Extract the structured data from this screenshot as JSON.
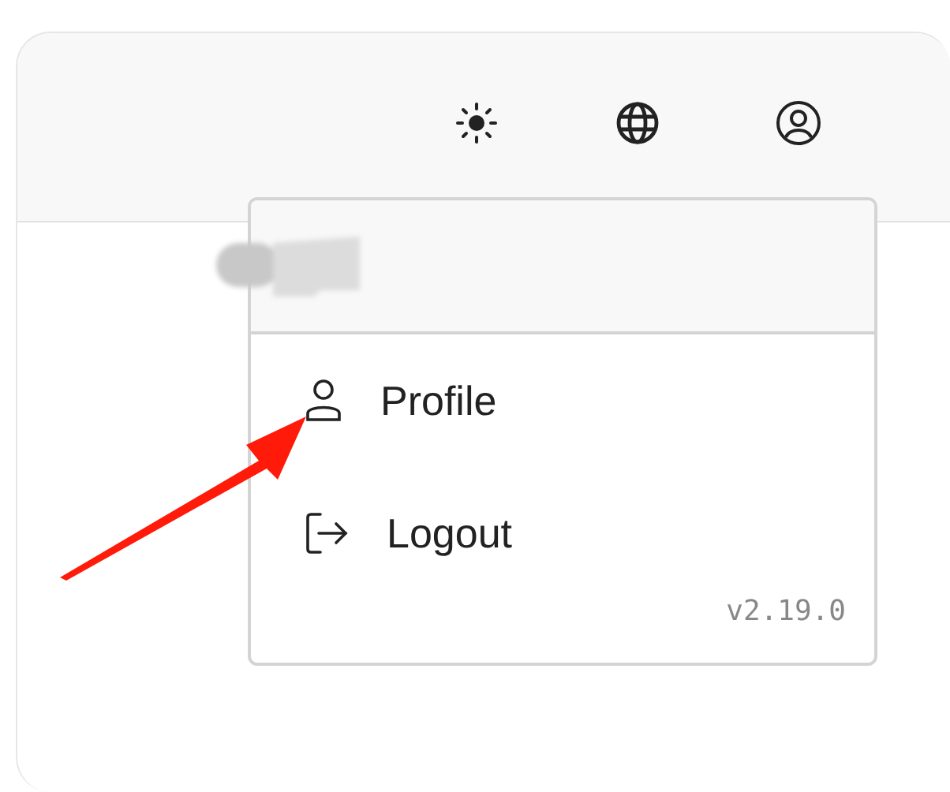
{
  "toolbar": [
    {
      "kind": "sun"
    },
    {
      "kind": "globe"
    },
    {
      "kind": "user"
    }
  ],
  "menu": {
    "items": [
      {
        "kind": "profile",
        "label": "Profile"
      },
      {
        "kind": "logout",
        "label": "Logout"
      }
    ],
    "version": "v2.19.0"
  }
}
